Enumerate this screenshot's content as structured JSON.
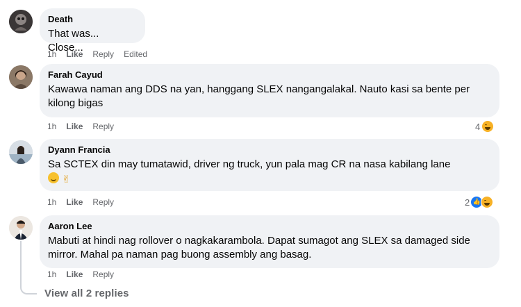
{
  "comments": [
    {
      "author": "Death",
      "text": "That was... Close...",
      "time": "1h",
      "like": "Like",
      "reply": "Reply",
      "edited": "Edited"
    },
    {
      "author": "Farah Cayud",
      "text": "Kawawa naman ang DDS na yan, hanggang SLEX nangangalakal. Nauto kasi sa bente per kilong bigas",
      "time": "1h",
      "like": "Like",
      "reply": "Reply",
      "reaction_count": "4",
      "reactions": [
        "haha-icon"
      ]
    },
    {
      "author": "Dyann Francia",
      "text": "Sa SCTEX din may tumatawid, driver ng truck, yun pala mag CR na nasa kabilang lane",
      "time": "1h",
      "like": "Like",
      "reply": "Reply",
      "reaction_count": "2",
      "reactions": [
        "like-icon",
        "haha-icon"
      ]
    },
    {
      "author": "Aaron Lee",
      "text": "Mabuti at hindi nag rollover o nagkakarambola. Dapat sumagot ang SLEX sa damaged side mirror. Mahal pa naman pag buong assembly ang basag.",
      "time": "1h",
      "like": "Like",
      "reply": "Reply"
    }
  ],
  "view_replies": "View all 2 replies",
  "colors": {
    "bubble": "#f0f2f5",
    "meta": "#65676b",
    "like_blue": "#1877f2",
    "haha_yellow": "#f7b125"
  }
}
